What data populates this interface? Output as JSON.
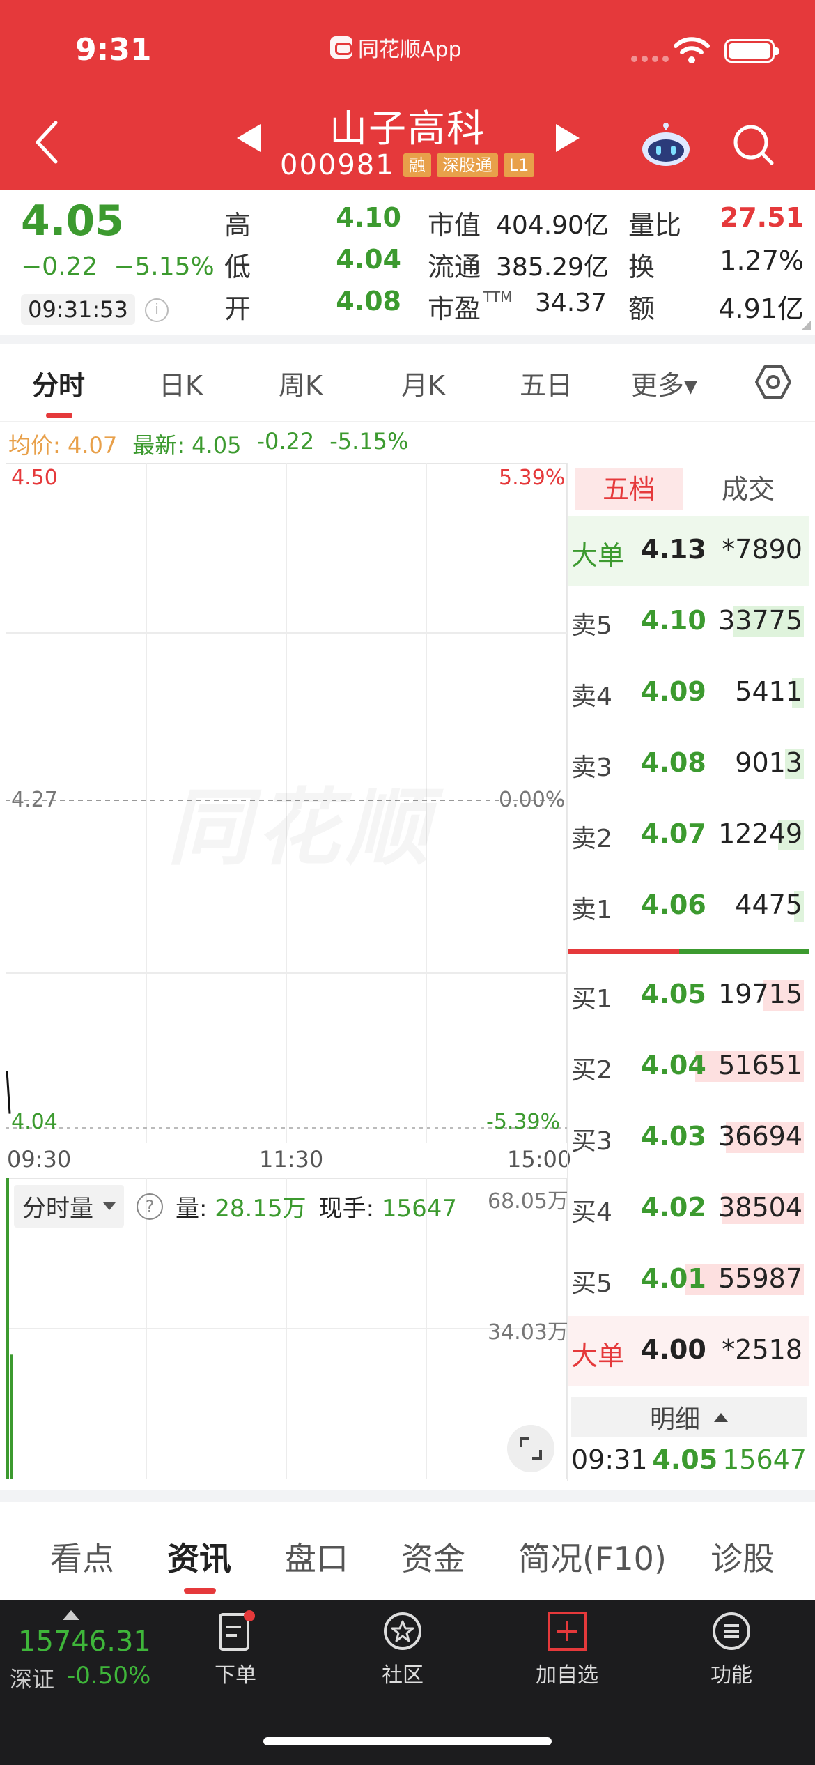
{
  "status_bar": {
    "time": "9:31",
    "app_link": "同花顺App"
  },
  "header": {
    "stock_name": "山子高科",
    "stock_code": "000981",
    "tags": [
      "融",
      "深股通",
      "L1"
    ]
  },
  "quote": {
    "price": "4.05",
    "change": "−0.22",
    "change_pct": "−5.15%",
    "time": "09:31:53",
    "info_icon": "i",
    "fields": [
      {
        "label": "高",
        "value": "4.10"
      },
      {
        "label": "低",
        "value": "4.04"
      },
      {
        "label": "开",
        "value": "4.08"
      }
    ],
    "fields2": [
      {
        "label": "市值",
        "value": "404.90亿"
      },
      {
        "label": "流通",
        "value": "385.29亿"
      },
      {
        "label": "市盈",
        "sup": "TTM",
        "value": "34.37"
      }
    ],
    "fields3": [
      {
        "label": "量比",
        "value": "27.51"
      },
      {
        "label": "换",
        "value": "1.27%"
      },
      {
        "label": "额",
        "value": "4.91亿"
      }
    ]
  },
  "chart_tabs": [
    "分时",
    "日K",
    "周K",
    "月K",
    "五日",
    "更多▾"
  ],
  "legend": {
    "avg": "均价: 4.07",
    "latest": "最新: 4.05",
    "change": "-0.22",
    "change_pct": "-5.15%"
  },
  "watermark": "同花顺",
  "chart_data": {
    "type": "line",
    "title": "",
    "x_ticks": [
      "09:30",
      "11:30",
      "15:00"
    ],
    "y_left_ticks": [
      "4.50",
      "4.27",
      "4.04"
    ],
    "y_right_ticks": [
      "5.39%",
      "0.00%",
      "-5.39%"
    ],
    "ylim": [
      4.04,
      4.5
    ],
    "prev_close": 4.27,
    "series": [
      {
        "x": [
          "09:30",
          "09:31"
        ],
        "values": [
          4.08,
          4.05
        ]
      }
    ],
    "volume": {
      "label": "分时量",
      "help_icon": "?",
      "total_label": "量: ",
      "total": "28.15万",
      "last_label": "现手: ",
      "last": "15647",
      "y_ticks": [
        "68.05万",
        "34.03万"
      ],
      "ylim": [
        0,
        68.05
      ],
      "bars": [
        68.05,
        28.15
      ]
    }
  },
  "order_book": {
    "tabs": [
      "五档",
      "成交"
    ],
    "big_sell": {
      "label": "大单",
      "price": "4.13",
      "volume": "*7890"
    },
    "sells": [
      {
        "label": "卖5",
        "price": "4.10",
        "volume": "33775",
        "fill": 0.6
      },
      {
        "label": "卖4",
        "price": "4.09",
        "volume": "5411",
        "fill": 0.1
      },
      {
        "label": "卖3",
        "price": "4.08",
        "volume": "9013",
        "fill": 0.16
      },
      {
        "label": "卖2",
        "price": "4.07",
        "volume": "12249",
        "fill": 0.22
      },
      {
        "label": "卖1",
        "price": "4.06",
        "volume": "4475",
        "fill": 0.08
      }
    ],
    "buys": [
      {
        "label": "买1",
        "price": "4.05",
        "volume": "19715",
        "fill": 0.35
      },
      {
        "label": "买2",
        "price": "4.04",
        "volume": "51651",
        "fill": 0.92
      },
      {
        "label": "买3",
        "price": "4.03",
        "volume": "36694",
        "fill": 0.66
      },
      {
        "label": "买4",
        "price": "4.02",
        "volume": "38504",
        "fill": 0.69
      },
      {
        "label": "买5",
        "price": "4.01",
        "volume": "55987",
        "fill": 1.0
      }
    ],
    "big_buy": {
      "label": "大单",
      "price": "4.00",
      "volume": "*2518"
    },
    "detail_label": "明细",
    "last_trade": {
      "time": "09:31",
      "price": "4.05",
      "volume": "15647"
    }
  },
  "sub_tabs": [
    "看点",
    "资讯",
    "盘口",
    "资金",
    "简况(F10)",
    "诊股"
  ],
  "bottom_nav": {
    "index": {
      "value": "15746.31",
      "name": "深证",
      "change": "-0.50%"
    },
    "items": [
      {
        "label": "下单",
        "icon": "order-icon"
      },
      {
        "label": "社区",
        "icon": "community-icon"
      },
      {
        "label": "加自选",
        "icon": "add-watchlist-icon"
      },
      {
        "label": "功能",
        "icon": "menu-icon"
      }
    ]
  },
  "colors": {
    "brand_red": "#e5393b",
    "down_green": "#3c9a2f",
    "up_red": "#e5393b",
    "avg_orange": "#e8a04a"
  }
}
